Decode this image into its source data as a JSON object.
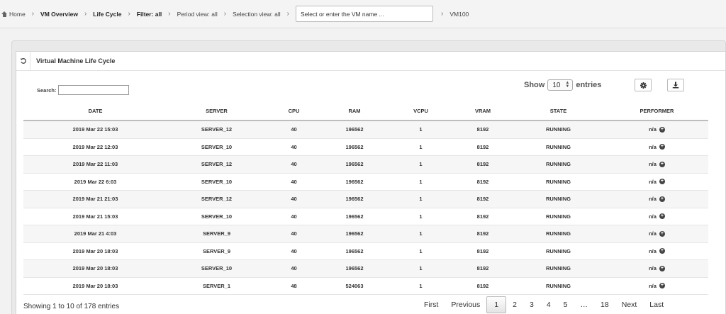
{
  "breadcrumb": {
    "home": "Home",
    "vm_overview": "VM Overview",
    "life_cycle": "Life Cycle",
    "filter": "Filter: all",
    "period": "Period view: all",
    "selection": "Selection view: all",
    "vm_input_placeholder": "Select or enter the VM name ...",
    "vm_name": "VM100"
  },
  "panel": {
    "title": "Virtual Machine Life Cycle",
    "search_label": "Search:",
    "show_label": "Show",
    "entries_value": "10",
    "entries_label": "entries"
  },
  "table": {
    "headers": {
      "date": "DATE",
      "server": "SERVER",
      "cpu": "CPU",
      "ram": "RAM",
      "vcpu": "VCPU",
      "vram": "VRAM",
      "state": "STATE",
      "performer": "PERFORMER"
    },
    "rows": [
      {
        "date": "2019 Mar 22 15:03",
        "server": "SERVER_12",
        "cpu": "40",
        "ram": "196562",
        "vcpu": "1",
        "vram": "8192",
        "state": "RUNNING",
        "performer": "n/a"
      },
      {
        "date": "2019 Mar 22 12:03",
        "server": "SERVER_10",
        "cpu": "40",
        "ram": "196562",
        "vcpu": "1",
        "vram": "8192",
        "state": "RUNNING",
        "performer": "n/a"
      },
      {
        "date": "2019 Mar 22 11:03",
        "server": "SERVER_12",
        "cpu": "40",
        "ram": "196562",
        "vcpu": "1",
        "vram": "8192",
        "state": "RUNNING",
        "performer": "n/a"
      },
      {
        "date": "2019 Mar 22 6:03",
        "server": "SERVER_10",
        "cpu": "40",
        "ram": "196562",
        "vcpu": "1",
        "vram": "8192",
        "state": "RUNNING",
        "performer": "n/a"
      },
      {
        "date": "2019 Mar 21 21:03",
        "server": "SERVER_12",
        "cpu": "40",
        "ram": "196562",
        "vcpu": "1",
        "vram": "8192",
        "state": "RUNNING",
        "performer": "n/a"
      },
      {
        "date": "2019 Mar 21 15:03",
        "server": "SERVER_10",
        "cpu": "40",
        "ram": "196562",
        "vcpu": "1",
        "vram": "8192",
        "state": "RUNNING",
        "performer": "n/a"
      },
      {
        "date": "2019 Mar 21 4:03",
        "server": "SERVER_9",
        "cpu": "40",
        "ram": "196562",
        "vcpu": "1",
        "vram": "8192",
        "state": "RUNNING",
        "performer": "n/a"
      },
      {
        "date": "2019 Mar 20 18:03",
        "server": "SERVER_9",
        "cpu": "40",
        "ram": "196562",
        "vcpu": "1",
        "vram": "8192",
        "state": "RUNNING",
        "performer": "n/a"
      },
      {
        "date": "2019 Mar 20 18:03",
        "server": "SERVER_10",
        "cpu": "40",
        "ram": "196562",
        "vcpu": "1",
        "vram": "8192",
        "state": "RUNNING",
        "performer": "n/a"
      },
      {
        "date": "2019 Mar 20 18:03",
        "server": "SERVER_1",
        "cpu": "48",
        "ram": "524063",
        "vcpu": "1",
        "vram": "8192",
        "state": "RUNNING",
        "performer": "n/a"
      }
    ]
  },
  "footer": {
    "info": "Showing 1 to 10 of 178 entries",
    "pager": [
      "First",
      "Previous",
      "1",
      "2",
      "3",
      "4",
      "5",
      "…",
      "18",
      "Next",
      "Last"
    ],
    "current_page": "1"
  }
}
